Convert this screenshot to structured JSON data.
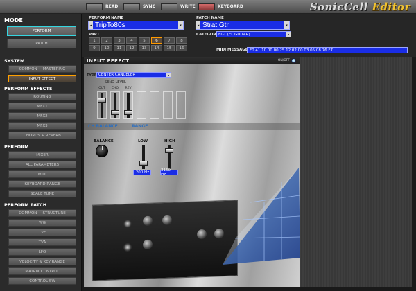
{
  "toolbar": {
    "buttons": [
      {
        "label": "READ"
      },
      {
        "label": "SYNC"
      },
      {
        "label": "WRITE"
      },
      {
        "label": "KEYBOARD"
      }
    ],
    "logo_part1": "SonicCell",
    "logo_part2": "Editor"
  },
  "header": {
    "perform_name_label": "PERFORM NAME",
    "perform_name": "TripTo80s",
    "part_label": "PART",
    "parts": [
      "1",
      "2",
      "3",
      "4",
      "5",
      "6",
      "7",
      "8",
      "9",
      "10",
      "11",
      "12",
      "13",
      "14",
      "15",
      "16"
    ],
    "selected_part": "6",
    "patch_name_label": "PATCH NAME",
    "patch_name": "Strat Gtr",
    "category_label": "CATEGORY",
    "category": "EGT (EL.GUITAR)",
    "midi_message_label": "MIDI MESSAGE",
    "midi_message": "F0 41 10 00 00 25 12 02 00 03 05 08 76 F7"
  },
  "sidebar": {
    "mode_title": "MODE",
    "mode_buttons": [
      "PERFORM",
      "PATCH"
    ],
    "system_title": "SYSTEM",
    "system_items": [
      "COMMON + MASTERING",
      "INPUT EFFECT"
    ],
    "perform_effects_title": "PERFORM EFFECTS",
    "perform_effects_items": [
      "ROUTING",
      "MFX1",
      "MFX2",
      "MFX3",
      "CHORUS + REVERB"
    ],
    "perform_title": "PERFORM",
    "perform_items": [
      "MIXER",
      "ALL PARAMETERS",
      "MIDI",
      "KEYBOARD RANGE",
      "SCALE TUNE"
    ],
    "perform_patch_title": "PERFORM PATCH",
    "perform_patch_items": [
      "COMMON + STRUCTURE",
      "WG",
      "TVF",
      "TVA",
      "LFO",
      "VELOCITY & KEY RANGE",
      "MATRIX CONTROL",
      "CONTROL SW"
    ]
  },
  "main": {
    "title": "INPUT EFFECT",
    "onoff_label": "ON/OFF",
    "type_label": "TYPE",
    "type_value": "CENTER CANCELER",
    "send_level_label": "SEND LEVEL",
    "send_columns": [
      "OUT",
      "CHO",
      "REV"
    ],
    "send_levels": [
      0.75,
      0.15,
      0.15
    ],
    "tabs": [
      "CH BALANCE",
      "RANGE"
    ],
    "balance_label": "BALANCE",
    "low_label": "LOW",
    "low_value": "200 Hz",
    "low_level": 0.2,
    "high_label": "HIGH",
    "high_value": "3150 Hz",
    "high_level": 0.85
  },
  "colors": {
    "field_blue": "#1a2de6",
    "selected_orange": "#ffa000",
    "active_cyan": "#35d6e0",
    "logo_yellow": "#f0c230"
  }
}
